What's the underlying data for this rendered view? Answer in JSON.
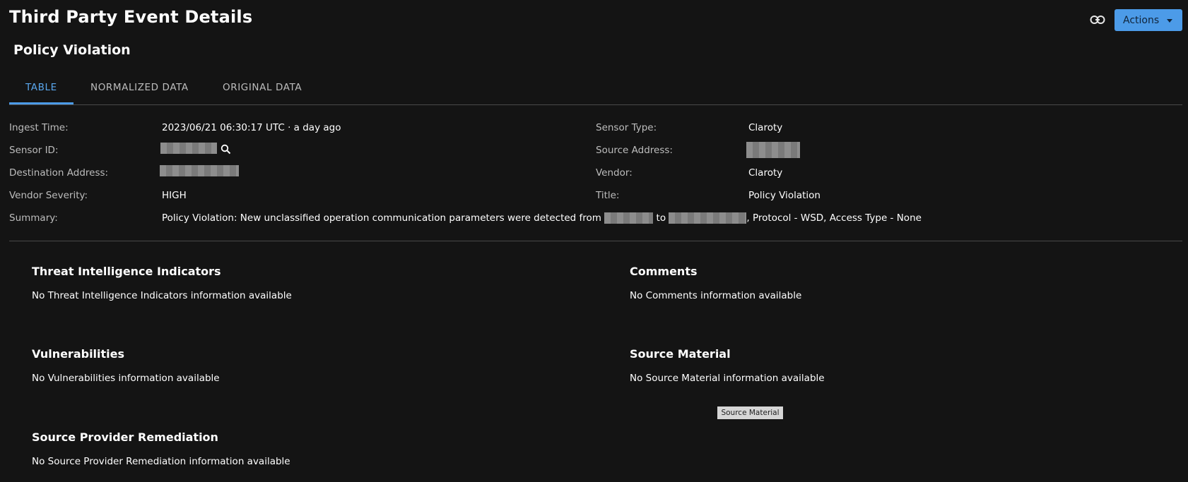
{
  "header": {
    "title": "Third Party Event Details",
    "actions_label": "Actions"
  },
  "event": {
    "title": "Policy Violation"
  },
  "tabs": [
    {
      "label": "TABLE",
      "active": true
    },
    {
      "label": "NORMALIZED DATA",
      "active": false
    },
    {
      "label": "ORIGINAL DATA",
      "active": false
    }
  ],
  "fields": {
    "ingest_time": {
      "label": "Ingest Time:",
      "value": "2023/06/21 06:30:17 UTC · a day ago"
    },
    "sensor_type": {
      "label": "Sensor Type:",
      "value": "Claroty"
    },
    "sensor_id": {
      "label": "Sensor ID:"
    },
    "source_address": {
      "label": "Source Address:"
    },
    "destination_address": {
      "label": "Destination Address:"
    },
    "vendor": {
      "label": "Vendor:",
      "value": "Claroty"
    },
    "vendor_severity": {
      "label": "Vendor Severity:",
      "value": "HIGH"
    },
    "title": {
      "label": "Title:",
      "value": "Policy Violation"
    },
    "summary": {
      "label": "Summary:",
      "prefix": "Policy Violation: New unclassified operation communication parameters were detected from",
      "middle": "to",
      "suffix": ", Protocol - WSD, Access Type - None"
    }
  },
  "sections": {
    "threat_intel": {
      "title": "Threat Intelligence Indicators",
      "text": "No Threat Intelligence Indicators information available"
    },
    "comments": {
      "title": "Comments",
      "text": "No Comments information available"
    },
    "vulnerabilities": {
      "title": "Vulnerabilities",
      "text": "No Vulnerabilities information available"
    },
    "source_material": {
      "title": "Source Material",
      "text": "No Source Material information available",
      "button_label": "Source Material"
    },
    "remediation": {
      "title": "Source Provider Remediation",
      "text": "No Source Provider Remediation information available"
    }
  },
  "icons": {
    "link": "link-icon",
    "search": "search-icon",
    "caret": "caret-down-icon"
  },
  "colors": {
    "background": "#141414",
    "accent": "#4c9be8",
    "active_tab": "#5aa7ee",
    "label": "#bdbdbd"
  }
}
